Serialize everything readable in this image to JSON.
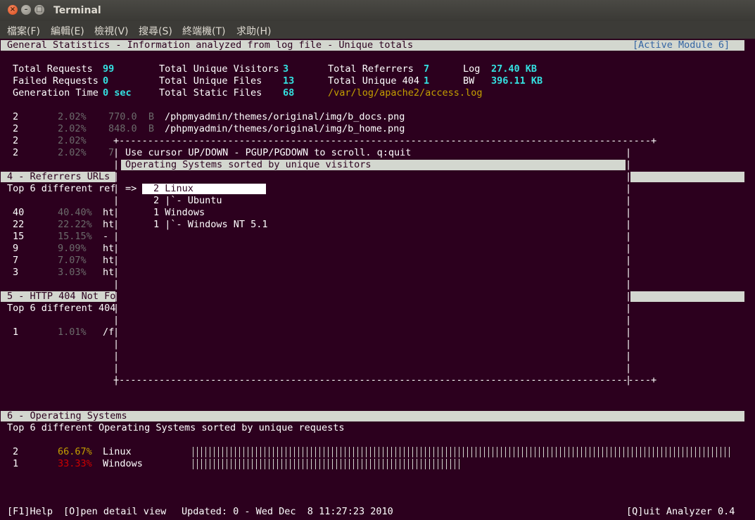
{
  "window": {
    "title": "Terminal"
  },
  "menu": [
    "檔案(F)",
    "編輯(E)",
    "檢視(V)",
    "搜尋(S)",
    "終端機(T)",
    "求助(H)"
  ],
  "header": {
    "title": "General Statistics - Information analyzed from log file - Unique totals",
    "module": "[Active Module 6]"
  },
  "stats": {
    "total_requests_label": "Total Requests",
    "total_requests": "99",
    "failed_requests_label": "Failed Requests",
    "failed_requests": "0",
    "generation_time_label": "Generation Time",
    "generation_time": "0 sec",
    "unique_visitors_label": "Total Unique Visitors",
    "unique_visitors": "3",
    "unique_files_label": "Total Unique Files",
    "unique_files": "13",
    "static_files_label": "Total Static Files",
    "static_files": "68",
    "referrers_label": "Total Referrers",
    "referrers": "7",
    "unique_404_label": "Total Unique 404",
    "unique_404": "1",
    "log_path": "/var/log/apache2/access.log",
    "log_label": "Log",
    "log_size": "27.40 KB",
    "bw_label": "BW",
    "bw_size": "396.11 KB"
  },
  "files": [
    {
      "count": "2",
      "pct": "2.02%",
      "size": "770.0  B",
      "path": "/phpmyadmin/themes/original/img/b_docs.png"
    },
    {
      "count": "2",
      "pct": "2.02%",
      "size": "848.0  B",
      "path": "/phpmyadmin/themes/original/img/b_home.png"
    },
    {
      "count": "2",
      "pct": "2.02%",
      "size": "",
      "path": ""
    },
    {
      "count": "2",
      "pct": "2.02%",
      "size": "7",
      "path": ""
    }
  ],
  "referrers": {
    "title": "4 - Referrers URLs",
    "subtitle": "Top 6 different ref",
    "rows": [
      {
        "count": "40",
        "pct": "40.40%",
        "url": "ht"
      },
      {
        "count": "22",
        "pct": "22.22%",
        "url": "ht"
      },
      {
        "count": "15",
        "pct": "15.15%",
        "url": "-"
      },
      {
        "count": "9",
        "pct": "9.09%",
        "url": "ht"
      },
      {
        "count": "7",
        "pct": "7.07%",
        "url": "ht"
      },
      {
        "count": "3",
        "pct": "3.03%",
        "url": "ht"
      }
    ]
  },
  "notfound": {
    "title": "5 - HTTP 404 Not Fo",
    "subtitle": "Top 6 different 404",
    "rows": [
      {
        "count": "1",
        "pct": "1.01%",
        "url": "/f"
      }
    ]
  },
  "dialog": {
    "hint": "Use cursor UP/DOWN - PGUP/PGDOWN to scroll. q:quit",
    "title": "Operating Systems sorted by unique visitors",
    "cursor": "=>",
    "items": [
      {
        "text": "2 Linux"
      },
      {
        "text": "2 |`- Ubuntu"
      },
      {
        "text": "1 Windows"
      },
      {
        "text": "1 |`- Windows NT 5.1"
      }
    ]
  },
  "os": {
    "title": "6 - Operating Systems",
    "subtitle": "Top 6 different Operating Systems sorted by unique requests",
    "rows": [
      {
        "count": "2",
        "pct": "66.67%",
        "name": "Linux",
        "share": 66.67
      },
      {
        "count": "1",
        "pct": "33.33%",
        "name": "Windows",
        "share": 33.33
      }
    ]
  },
  "footer": {
    "help": "[F1]Help",
    "detail": "[O]pen detail view",
    "updated": "Updated: 0 - Wed Dec  8 11:27:23 2010",
    "quit": "[Q]uit Analyzer 0.4"
  },
  "colors": {
    "terminal_bg": "#2c001e",
    "bar_bg": "#d3d7cf",
    "value_cyan": "#34e2e2",
    "path_yellow": "#c4a000",
    "pct_red": "#cc0000",
    "module_blue": "#3465a4"
  }
}
